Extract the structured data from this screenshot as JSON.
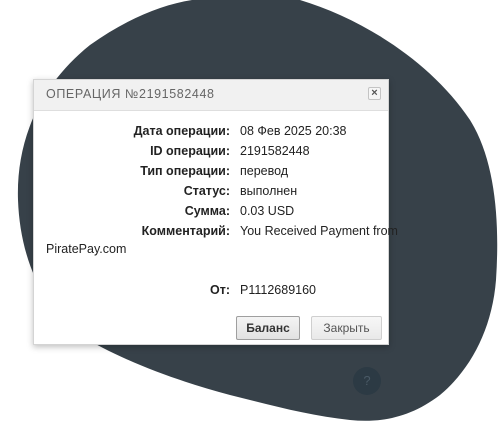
{
  "theme": {
    "blob_color": "#374149",
    "modal_bg": "#ffffff",
    "header_bg": "#f1f1f1"
  },
  "dialog": {
    "title": "ОПЕРАЦИЯ №2191582448",
    "close_icon": "close-icon",
    "fields": [
      {
        "label": "Дата операции:",
        "value": "08 Фев 2025 20:38"
      },
      {
        "label": "ID операции:",
        "value": "2191582448"
      },
      {
        "label": "Тип операции:",
        "value": "перевод"
      },
      {
        "label": "Статус:",
        "value": "выполнен"
      },
      {
        "label": "Сумма:",
        "value": "0.03 USD"
      },
      {
        "label": "Комментарий:",
        "value": "You Received Payment from"
      }
    ],
    "comment_continuation": "PiratePay.com",
    "from": {
      "label": "От:",
      "value": "P1112689160"
    },
    "buttons": {
      "balance": "Баланс",
      "close": "Закрыть"
    }
  },
  "help_icon": "help-icon"
}
